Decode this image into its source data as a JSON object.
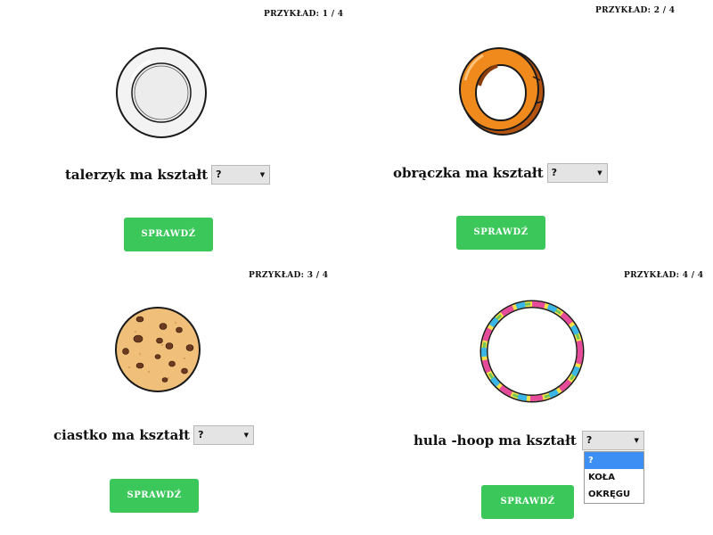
{
  "examples": [
    {
      "counter": "PRZYKŁAD: 1 / 4",
      "question": "talerzyk ma kształt",
      "select_value": "?",
      "check_label": "SPRAWDŹ",
      "icon": "plate-icon"
    },
    {
      "counter": "PRZYKŁAD: 2 / 4",
      "question": "obrączka ma kształt",
      "select_value": "?",
      "check_label": "SPRAWDŹ",
      "icon": "ring-icon"
    },
    {
      "counter": "PRZYKŁAD: 3 / 4",
      "question": "ciastko ma kształt",
      "select_value": "?",
      "check_label": "SPRAWDŹ",
      "icon": "cookie-icon"
    },
    {
      "counter": "PRZYKŁAD: 4 / 4",
      "question": "hula -hoop ma kształt",
      "select_value": "?",
      "check_label": "SPRAWDŹ",
      "icon": "hula-hoop-icon"
    }
  ],
  "dropdown_open": {
    "options": [
      "?",
      "KOŁA",
      "OKRĘGU"
    ],
    "highlighted": "?"
  },
  "colors": {
    "button_green": "#3cc75a",
    "select_bg": "#e4e4e4",
    "highlight_blue": "#3d8ff3"
  }
}
